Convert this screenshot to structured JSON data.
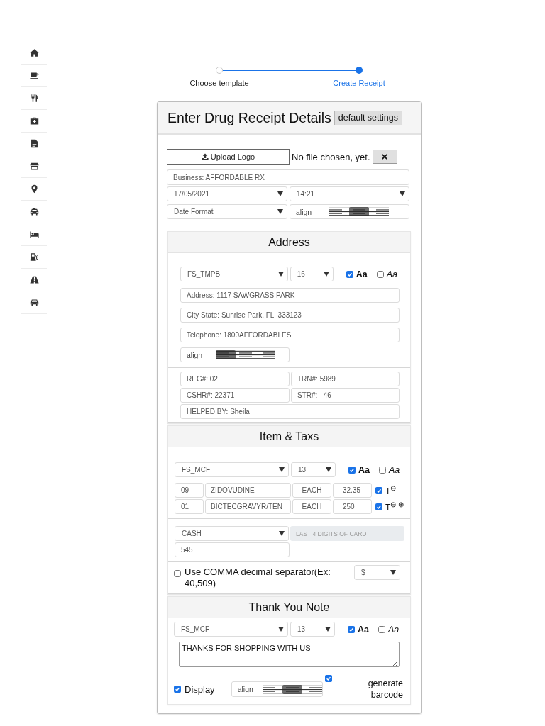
{
  "steps": [
    {
      "label": "Choose template",
      "selected": false
    },
    {
      "label": "Create Receipt",
      "selected": true
    }
  ],
  "form": {
    "title": "Enter Drug Receipt Details",
    "default_button": "default settings",
    "upload": {
      "button": "Upload Logo",
      "status": "No file chosen, yet."
    },
    "business": "Business: AFFORDABLE RX",
    "date": "17/05/2021",
    "time": "14:21",
    "date_format": "Date Format",
    "align": {
      "label": "align",
      "options": [
        {
          "kind": "left",
          "selected": false
        },
        {
          "kind": "center",
          "selected": true
        },
        {
          "kind": "right",
          "selected": false
        }
      ]
    }
  },
  "address_section": {
    "title": "Address",
    "font": "FS_TMPB",
    "size": "16",
    "styles": [
      {
        "kind": "bold",
        "label": "Aa",
        "checked": true
      },
      {
        "kind": "italic",
        "label": "Aa",
        "checked": false
      }
    ],
    "lines": [
      "Address: 1117 SAWGRASS PARK",
      "City State: Sunrise Park, FL  333123",
      "Telephone: 1800AFFORDABLES"
    ],
    "align": {
      "label": "align",
      "options": [
        {
          "kind": "left",
          "selected": true
        },
        {
          "kind": "center",
          "selected": false
        },
        {
          "kind": "right",
          "selected": false
        }
      ]
    },
    "fields": [
      "REG#: 02",
      "TRN#: 5989",
      "CSHR#: 22371",
      "STR#:   46",
      "HELPED BY: Sheila"
    ]
  },
  "items_section": {
    "title": "Item & Taxs",
    "font": "FS_MCF",
    "size": "13",
    "styles": [
      {
        "kind": "bold",
        "label": "Aa",
        "checked": true
      },
      {
        "kind": "italic",
        "label": "Aa",
        "checked": false
      }
    ],
    "items": [
      {
        "qty": "09",
        "name": "ZIDOVUDINE",
        "unit": "EACH",
        "price": "32.35",
        "taxed": true,
        "tax_mark": "T$^{⊖}$"
      },
      {
        "qty": "01",
        "name": "BICTECGRAVYR/TEN",
        "unit": "EACH",
        "price": "250",
        "taxed": true,
        "tax_mark": "T$^{⊖ ⊕}$"
      }
    ],
    "payment": "CASH",
    "card_digits": {
      "placeholder": "LAST 4 DIGITS OF CARD",
      "disabled": true
    },
    "amount": "545",
    "comma": {
      "label": "Use COMMA decimal separator(Ex: 40,509)",
      "checked": false
    },
    "currency": "$"
  },
  "note_section": {
    "title": "Thank You Note",
    "font": "FS_MCF",
    "size": "13",
    "styles": [
      {
        "kind": "bold",
        "label": "Aa",
        "checked": true
      },
      {
        "kind": "italic",
        "label": "Aa",
        "checked": false
      }
    ],
    "message": "THANKS FOR SHOPPING WITH US",
    "display": {
      "label": "Display",
      "checked": true
    },
    "align": {
      "label": "align",
      "options": [
        {
          "kind": "left",
          "selected": false
        },
        {
          "kind": "center",
          "selected": true
        },
        {
          "kind": "right",
          "selected": false
        }
      ]
    },
    "barcode": {
      "label": "generate barcode",
      "checked": true
    }
  }
}
